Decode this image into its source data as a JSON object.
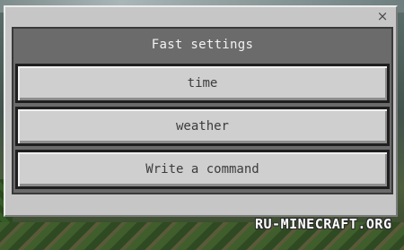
{
  "dialog": {
    "title": "Fast settings",
    "close_glyph": "×",
    "buttons": [
      {
        "label": "time"
      },
      {
        "label": "weather"
      },
      {
        "label": "Write a command"
      }
    ]
  },
  "watermark": {
    "text": "RU-MINECRAFT.ORG"
  },
  "colors": {
    "dialog_bg": "#c6c6c6",
    "panel_bg": "#6b6b6b",
    "button_bg": "#cfcfcf",
    "title_text": "#f2f2f2",
    "button_text": "#3c3c3c"
  }
}
